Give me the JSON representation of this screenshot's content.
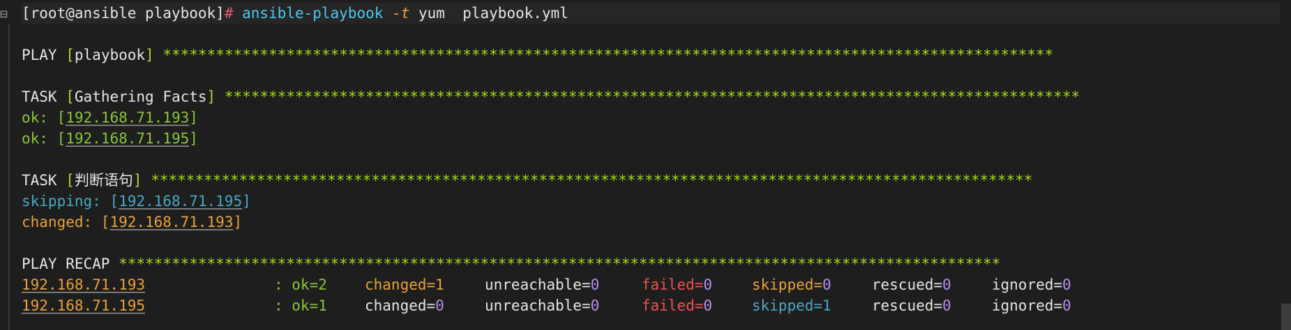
{
  "prompt": {
    "text": "[root@ansible playbook]",
    "hash": "#",
    "command": "ansible-playbook",
    "flag": "-t",
    "args": "yum  playbook.yml"
  },
  "play": {
    "keyword": "PLAY",
    "name": "playbook",
    "stars": "*****************************************************************************************************"
  },
  "task1": {
    "keyword": "TASK",
    "name": "Gathering Facts",
    "stars": "*************************************************************************************************",
    "results": [
      {
        "status": "ok:",
        "host": "192.168.71.193"
      },
      {
        "status": "ok:",
        "host": "192.168.71.195"
      }
    ]
  },
  "task2": {
    "keyword": "TASK",
    "name": "判断语句",
    "stars": "****************************************************************************************************",
    "results": [
      {
        "status": "skipping:",
        "host": "192.168.71.195"
      },
      {
        "status": "changed:",
        "host": "192.168.71.193"
      }
    ]
  },
  "recap": {
    "keyword": "PLAY RECAP",
    "stars": "****************************************************************************************************",
    "rows": [
      {
        "host": "192.168.71.193",
        "ok": ": ok=2",
        "changed_k": "changed=",
        "changed_v": "1",
        "unreachable_k": "unreachable=",
        "unreachable_v": "0",
        "failed_k": "failed=",
        "failed_v": "0",
        "skipped_k": "skipped=",
        "skipped_v": "0",
        "rescued_k": "rescued=",
        "rescued_v": "0",
        "ignored_k": "ignored=",
        "ignored_v": "0"
      },
      {
        "host": "192.168.71.195",
        "ok": ": ok=1",
        "changed_k": "changed=",
        "changed_v": "0",
        "unreachable_k": "unreachable=",
        "unreachable_v": "0",
        "failed_k": "failed=",
        "failed_v": "0",
        "skipped_k": "skipped=",
        "skipped_v": "1",
        "rescued_k": "rescued=",
        "rescued_v": "0",
        "ignored_k": "ignored=",
        "ignored_v": "0"
      }
    ]
  },
  "colors": {
    "background": "#1e1e1e",
    "ok": "#8cc43c",
    "changed": "#e8a23a",
    "skipped": "#4aa8c4",
    "failed": "#f05050",
    "zero_value": "#b88cf0",
    "stars": "#a8d81c",
    "command": "#4cc8f0"
  }
}
